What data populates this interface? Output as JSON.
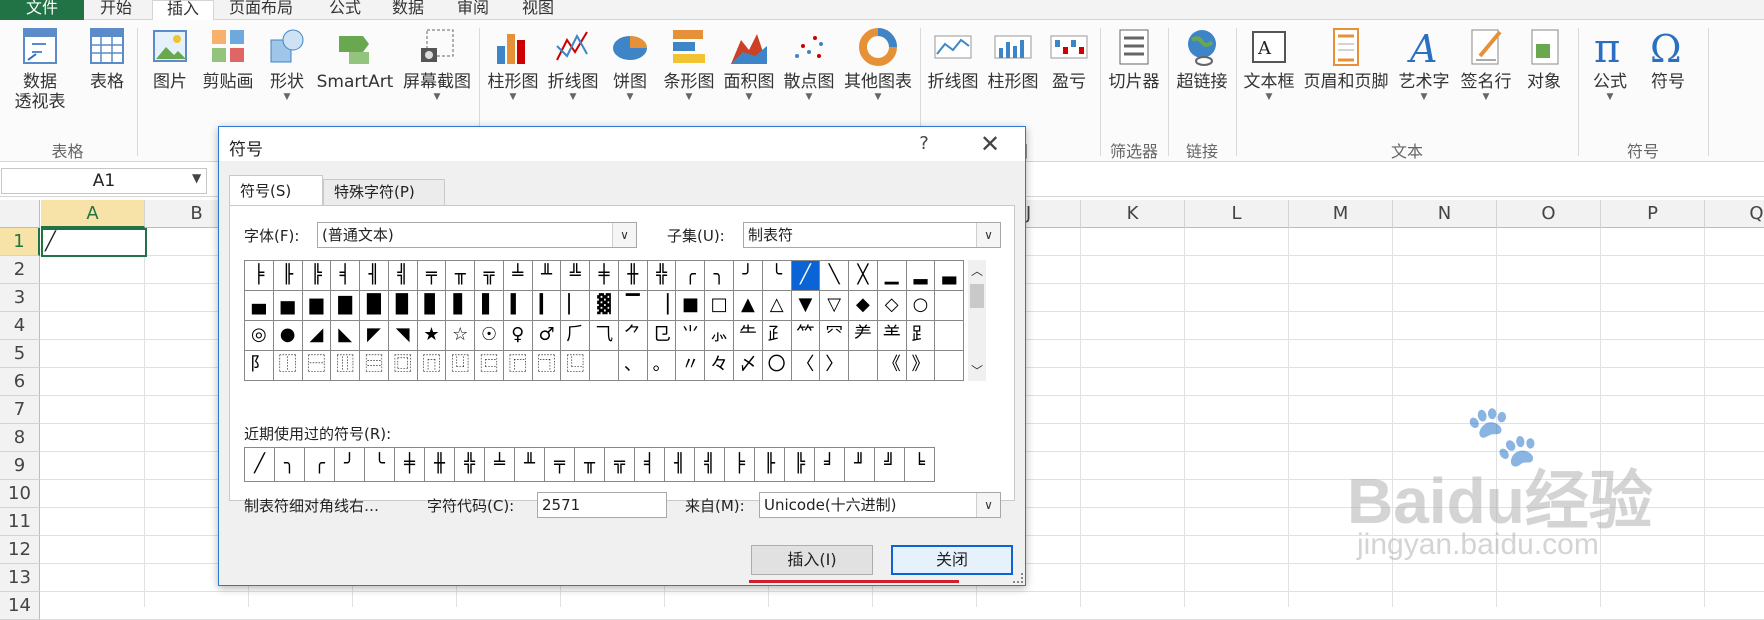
{
  "ribbon_tabs": [
    "文件",
    "开始",
    "插入",
    "页面布局",
    "公式",
    "数据",
    "审阅",
    "视图"
  ],
  "ribbon": {
    "buttons": [
      {
        "label": "数据",
        "label2": "透视表",
        "icon": "pivot-table-icon"
      },
      {
        "label": "表格",
        "icon": "table-icon"
      },
      {
        "label": "图片",
        "icon": "picture-icon"
      },
      {
        "label": "剪贴画",
        "icon": "clipart-icon"
      },
      {
        "label": "形状",
        "icon": "shapes-icon"
      },
      {
        "label": "SmartArt",
        "icon": "smartart-icon"
      },
      {
        "label": "屏幕截图",
        "icon": "screenshot-icon"
      },
      {
        "label": "柱形图",
        "icon": "column-chart-icon"
      },
      {
        "label": "折线图",
        "icon": "line-chart-icon"
      },
      {
        "label": "饼图",
        "icon": "pie-chart-icon"
      },
      {
        "label": "条形图",
        "icon": "bar-chart-icon"
      },
      {
        "label": "面积图",
        "icon": "area-chart-icon"
      },
      {
        "label": "散点图",
        "icon": "scatter-chart-icon"
      },
      {
        "label": "其他图表",
        "icon": "other-charts-icon"
      },
      {
        "label": "折线图",
        "icon": "sparkline-line-icon"
      },
      {
        "label": "柱形图",
        "icon": "sparkline-column-icon"
      },
      {
        "label": "盈亏",
        "icon": "sparkline-winloss-icon"
      },
      {
        "label": "切片器",
        "icon": "slicer-icon"
      },
      {
        "label": "超链接",
        "icon": "hyperlink-icon"
      },
      {
        "label": "文本框",
        "icon": "textbox-icon"
      },
      {
        "label": "页眉和页脚",
        "icon": "header-footer-icon"
      },
      {
        "label": "艺术字",
        "icon": "wordart-icon"
      },
      {
        "label": "签名行",
        "icon": "signature-line-icon"
      },
      {
        "label": "对象",
        "icon": "object-icon"
      },
      {
        "label": "公式",
        "icon": "equation-icon"
      },
      {
        "label": "符号",
        "icon": "symbol-icon"
      }
    ],
    "groups": [
      "表格",
      "图",
      "筛选器",
      "链接",
      "文本",
      "符号"
    ]
  },
  "namebox": "A1",
  "columns": [
    "A",
    "B",
    "C",
    "D",
    "E",
    "F",
    "G",
    "H",
    "I",
    "J",
    "K",
    "L",
    "M",
    "N",
    "O",
    "P",
    "Q"
  ],
  "rows": [
    "1",
    "2",
    "3",
    "4",
    "5",
    "6",
    "7",
    "8",
    "9",
    "10",
    "11",
    "12",
    "13",
    "14"
  ],
  "cell_a1": "╱",
  "dialog": {
    "title": "符号",
    "help": "?",
    "tabs": [
      "符号(S)",
      "特殊字符(P)"
    ],
    "font_label": "字体(F):",
    "font_value": "(普通文本)",
    "subset_label": "子集(U):",
    "subset_value": "制表符",
    "symbols": [
      [
        "╞",
        "╟",
        "╠",
        "╡",
        "╢",
        "╣",
        "╤",
        "╥",
        "╦",
        "╧",
        "╨",
        "╩",
        "╪",
        "╫",
        "╬",
        "╭",
        "╮",
        "╯",
        "╰",
        "╱",
        "╲",
        "╳",
        "▁",
        "▂",
        "▃"
      ],
      [
        "▄",
        "▅",
        "▆",
        "▇",
        "█",
        "▉",
        "▊",
        "▋",
        "▌",
        "▍",
        "▎",
        "▏",
        "▓",
        "▔",
        "▕",
        "■",
        "□",
        "▲",
        "△",
        "▼",
        "▽",
        "◆",
        "◇",
        "○",
        ""
      ],
      [
        "◎",
        "●",
        "◢",
        "◣",
        "◤",
        "◥",
        "★",
        "☆",
        "☉",
        "♀",
        "♂",
        "⺁",
        "⺄",
        "⺈",
        "⺋",
        "⺌",
        "⺗",
        "⺧",
        "⺪",
        "⺮",
        "⺳",
        "⺶",
        "⺷",
        "⻊",
        ""
      ],
      [
        "⻖",
        "⿰",
        "⿱",
        "⿲",
        "⿳",
        "⿴",
        "⿵",
        "⿶",
        "⿷",
        "⿸",
        "⿹",
        "⿺",
        "",
        "、",
        "。",
        "〃",
        "々",
        "〆",
        "〇",
        "〈",
        "〉",
        "",
        "《",
        "》",
        ""
      ]
    ],
    "selected_row": 0,
    "selected_col": 19,
    "recent_label": "近期使用过的符号(R):",
    "recent": [
      "╱",
      "╮",
      "╭",
      "╯",
      "╰",
      "╪",
      "╫",
      "╬",
      "╧",
      "╨",
      "╤",
      "╥",
      "╦",
      "╡",
      "╢",
      "╣",
      "╞",
      "╟",
      "╠",
      "╛",
      "╜",
      "╝",
      "╘"
    ],
    "char_name": "制表符细对角线右…",
    "code_label": "字符代码(C):",
    "code_value": "2571",
    "from_label": "来自(M):",
    "from_value": "Unicode(十六进制)",
    "insert_label": "插入(I)",
    "close_label": "关闭"
  },
  "watermark": {
    "big": "Baidu经验",
    "small": "jingyan.baidu.com"
  },
  "colors": {
    "accent": "#217346",
    "selection": "#0a64d6",
    "underline": "#d0202a"
  }
}
